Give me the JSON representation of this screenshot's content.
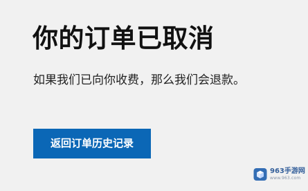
{
  "page": {
    "title": "你的订单已取消",
    "message": "如果我们已向你收费，那么我们会退款。",
    "button_label": "返回订单历史记录"
  },
  "watermark": {
    "main_text": "963手游网",
    "sub_text": "www.963.com",
    "icon": "box-logo-icon"
  },
  "colors": {
    "background": "#efefef",
    "title": "#111111",
    "message": "#222222",
    "button": "#0b67b6",
    "button_text": "#ffffff",
    "watermark_blue": "#1f4f91"
  }
}
